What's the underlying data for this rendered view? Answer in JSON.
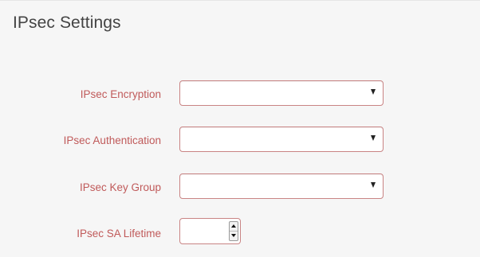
{
  "panel": {
    "title": "IPsec Settings"
  },
  "fields": {
    "encryption": {
      "label": "IPsec Encryption",
      "value": ""
    },
    "authentication": {
      "label": "IPsec Authentication",
      "value": ""
    },
    "key_group": {
      "label": "IPsec Key Group",
      "value": ""
    },
    "sa_lifetime": {
      "label": "IPsec SA Lifetime",
      "value": ""
    }
  },
  "colors": {
    "label": "#c05a5a",
    "field_border": "#c98484",
    "panel_bg": "#f6f6f6",
    "title": "#444444"
  },
  "icons": {
    "dropdown": "chevron-down-icon",
    "spinner_up": "caret-up-icon",
    "spinner_down": "caret-down-icon"
  }
}
